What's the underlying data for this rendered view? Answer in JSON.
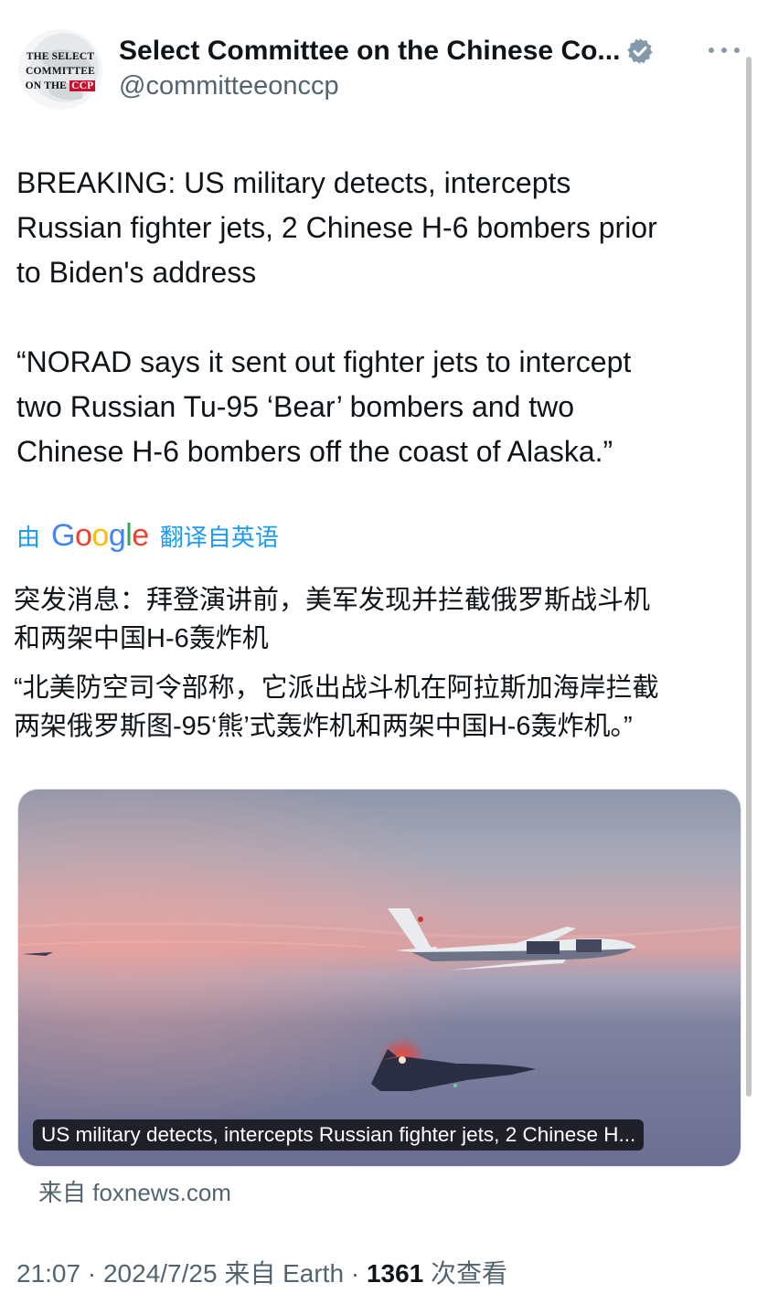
{
  "author": {
    "display_name": "Select Committee on the Chinese Co...",
    "handle": "@committeeonccp",
    "avatar_text": [
      "THE SELECT",
      "COMMITTEE",
      "ON THE",
      "CCP"
    ]
  },
  "tweet": {
    "lines": [
      "BREAKING: US military detects, intercepts",
      "Russian fighter jets, 2 Chinese H-6 bombers prior",
      "to Biden's address",
      "",
      "“NORAD says it sent out fighter jets to intercept",
      "two Russian Tu-95 ‘Bear’ bombers and two",
      "Chinese H-6 bombers off the coast of Alaska.”"
    ]
  },
  "translate": {
    "prefix": "由",
    "brand": "Google",
    "suffix": "翻译自英语"
  },
  "translation": {
    "para1": [
      "突发消息：拜登演讲前，美军发现并拦截俄罗斯战斗机",
      "和两架中国H-6轰炸机"
    ],
    "para2": [
      "“北美防空司令部称，它派出战斗机在阿拉斯加海岸拦截",
      "两架俄罗斯图-95‘熊’式轰炸机和两架中国H-6轰炸机。”"
    ]
  },
  "media": {
    "caption": "US military detects, intercepts Russian fighter jets, 2 Chinese H..."
  },
  "source": "来自 foxnews.com",
  "meta": {
    "time": "21:07",
    "date": "2024/7/25",
    "from": "来自 Earth",
    "views": "1361",
    "views_label": "次查看"
  },
  "colors": {
    "link": "#1d9bf0",
    "secondary_text": "#536471",
    "primary_text": "#0f1419",
    "verified": "#829aab"
  }
}
